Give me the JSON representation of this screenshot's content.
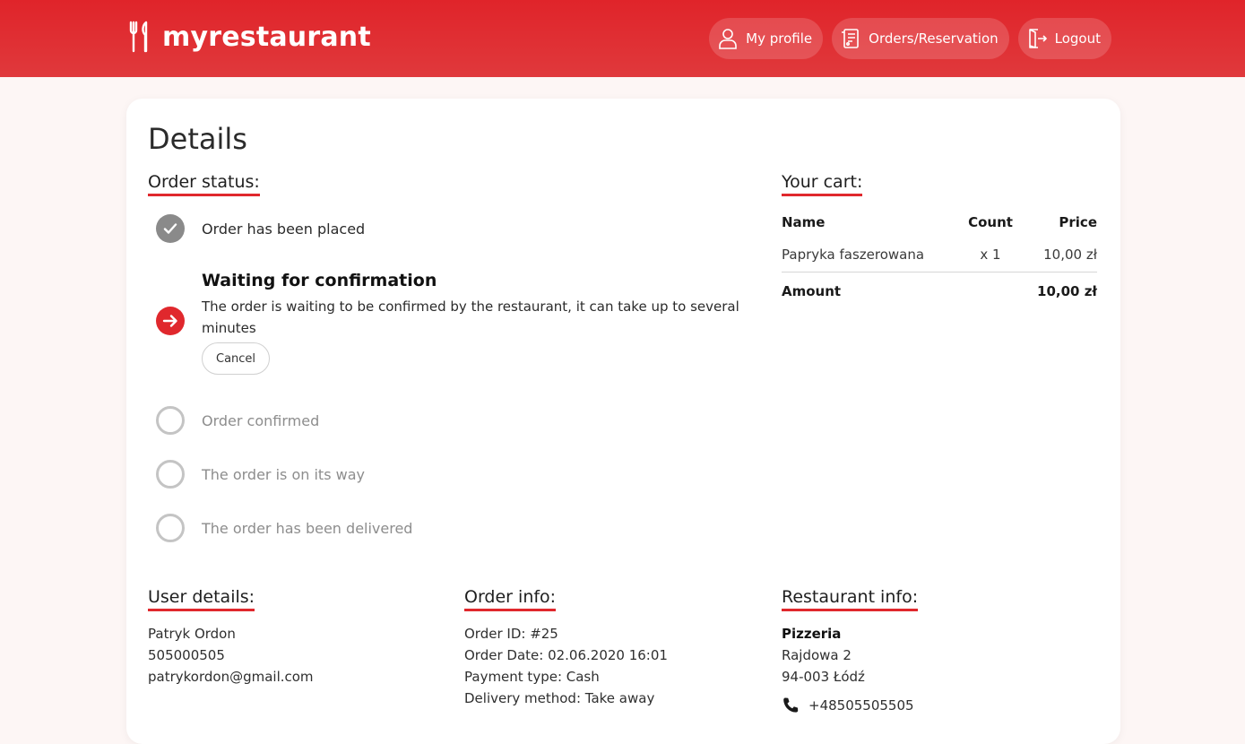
{
  "header": {
    "brand": "myrestaurant",
    "nav": [
      {
        "label": "My profile",
        "icon": "user-icon"
      },
      {
        "label": "Orders/Reservation",
        "icon": "receipt-icon"
      },
      {
        "label": "Logout",
        "icon": "logout-icon"
      }
    ]
  },
  "colors": {
    "accent": "#e0282d",
    "header_red": "#e0393c",
    "done_gray": "#8a8a8a",
    "pending_gray": "#c4c4c4"
  },
  "details": {
    "title": "Details",
    "order_status": {
      "heading": "Order status:",
      "steps": [
        {
          "label": "Order has been placed",
          "state": "done"
        },
        {
          "label": "Waiting for confirmation",
          "state": "active",
          "description": "The order is waiting to be confirmed by the restaurant, it can take up to several minutes",
          "action": "Cancel"
        },
        {
          "label": "Order confirmed",
          "state": "pending"
        },
        {
          "label": "The order is on its way",
          "state": "pending"
        },
        {
          "label": "The order has been delivered",
          "state": "pending"
        }
      ]
    },
    "cart": {
      "heading": "Your cart:",
      "columns": [
        "Name",
        "Count",
        "Price"
      ],
      "items": [
        {
          "name": "Papryka faszerowana",
          "count": "x 1",
          "price": "10,00 zł"
        }
      ],
      "amount_label": "Amount",
      "amount_value": "10,00 zł"
    },
    "user": {
      "heading": "User details:",
      "name": "Patryk Ordon",
      "phone": "505000505",
      "email": "patrykordon@gmail.com"
    },
    "order_info": {
      "heading": "Order info:",
      "id": "Order ID: #25",
      "date": "Order Date: 02.06.2020 16:01",
      "payment": "Payment type: Cash",
      "delivery": "Delivery method: Take away"
    },
    "restaurant": {
      "heading": "Restaurant info:",
      "name": "Pizzeria",
      "street": "Rajdowa 2",
      "city": "94-003 Łódź",
      "phone": "+48505505505"
    }
  }
}
